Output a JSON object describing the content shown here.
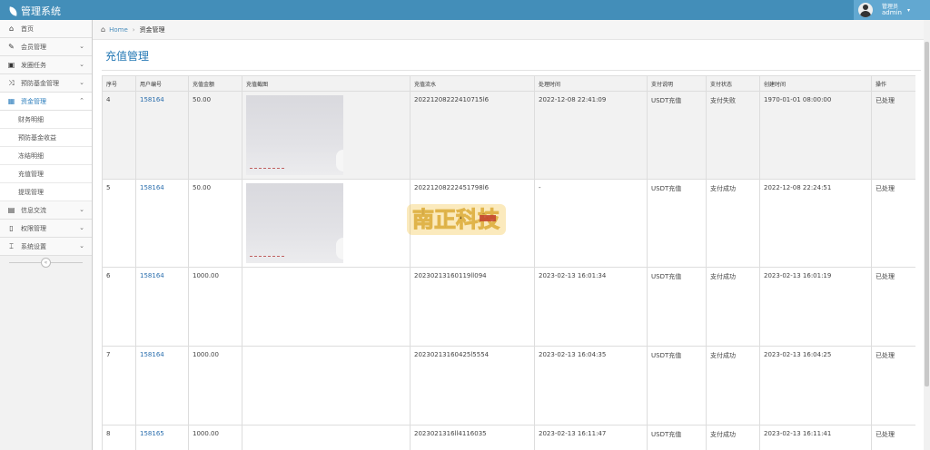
{
  "app": {
    "title": "管理系统"
  },
  "user": {
    "role": "管理员",
    "name": "admin"
  },
  "sidebar": {
    "items": [
      {
        "label": "首页"
      },
      {
        "label": "会员管理"
      },
      {
        "label": "发圈任务"
      },
      {
        "label": "预防基金管理"
      },
      {
        "label": "资金管理"
      },
      {
        "label": "信息交流"
      },
      {
        "label": "权限管理"
      },
      {
        "label": "系统设置"
      }
    ],
    "subitems": [
      {
        "label": "财务明细"
      },
      {
        "label": "预防基金收益"
      },
      {
        "label": "冻结明细"
      },
      {
        "label": "充值管理"
      },
      {
        "label": "提现管理"
      }
    ]
  },
  "breadcrumb": {
    "home": "Home",
    "current": "资金管理"
  },
  "page": {
    "title": "充值管理"
  },
  "table": {
    "headers": [
      "序号",
      "用户编号",
      "充值金额",
      "充值截图",
      "充值流水",
      "处理时间",
      "支付说明",
      "支付状态",
      "创建时间",
      "操作"
    ],
    "rows": [
      {
        "id": "4",
        "user": "158164",
        "amount": "50.00",
        "serial": "20221208222410715l6",
        "processed": "2022-12-08 22:41:09",
        "note": "USDT充值",
        "status": "支付失败",
        "created": "1970-01-01 08:00:00",
        "action": "已处理"
      },
      {
        "id": "5",
        "user": "158164",
        "amount": "50.00",
        "serial": "20221208222451798l6",
        "processed": "-",
        "note": "USDT充值",
        "status": "支付成功",
        "created": "2022-12-08 22:24:51",
        "action": "已处理"
      },
      {
        "id": "6",
        "user": "158164",
        "amount": "1000.00",
        "serial": "20230213160119ll094",
        "processed": "2023-02-13 16:01:34",
        "note": "USDT充值",
        "status": "支付成功",
        "created": "2023-02-13 16:01:19",
        "action": "已处理"
      },
      {
        "id": "7",
        "user": "158164",
        "amount": "1000.00",
        "serial": "20230213160425l5554",
        "processed": "2023-02-13 16:04:35",
        "note": "USDT充值",
        "status": "支付成功",
        "created": "2023-02-13 16:04:25",
        "action": "已处理"
      },
      {
        "id": "8",
        "user": "158165",
        "amount": "1000.00",
        "serial": "2023021316ll4116035",
        "processed": "2023-02-13 16:11:47",
        "note": "USDT充值",
        "status": "支付成功",
        "created": "2023-02-13 16:11:41",
        "action": "已处理"
      }
    ]
  },
  "watermark": {
    "text": "南正科技"
  }
}
